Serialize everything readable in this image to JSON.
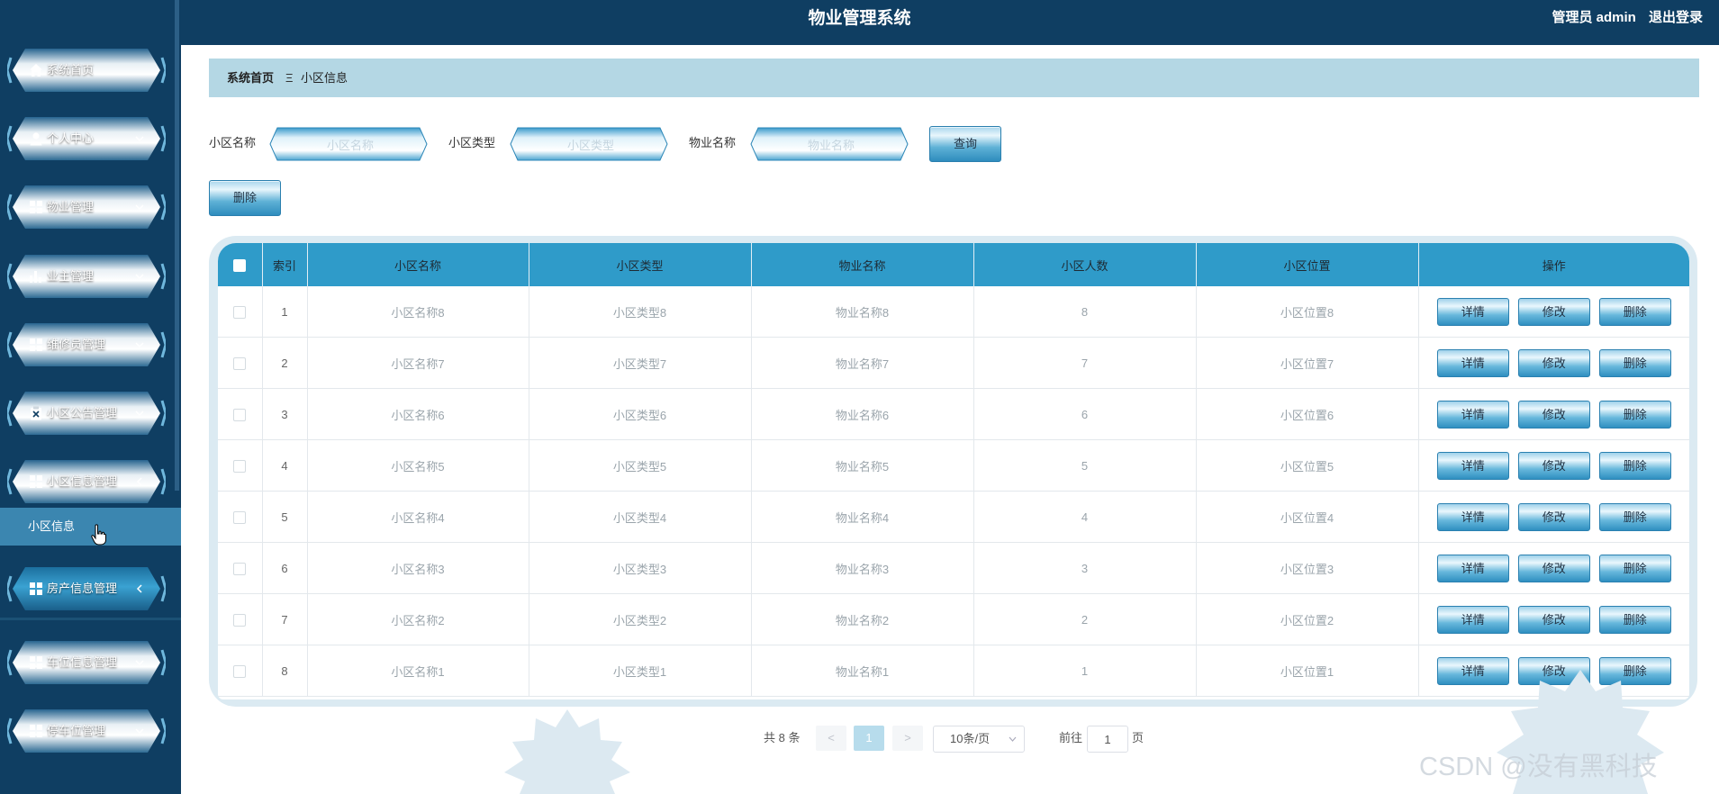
{
  "header": {
    "title": "物业管理系统",
    "user": "管理员 admin",
    "logout": "退出登录"
  },
  "sidebar": {
    "items": [
      {
        "label": "系统首页",
        "icon": "home-icon"
      },
      {
        "label": "个人中心",
        "icon": "user-icon"
      },
      {
        "label": "物业管理",
        "icon": "grid-icon"
      },
      {
        "label": "业主管理",
        "icon": "bar-chart-icon"
      },
      {
        "label": "维修员管理",
        "icon": "grid-icon"
      },
      {
        "label": "小区公告管理",
        "icon": "clipboard-icon"
      },
      {
        "label": "小区信息管理",
        "icon": "grid-icon"
      },
      {
        "label": "房产信息管理",
        "icon": "grid-icon"
      },
      {
        "label": "车位信息管理",
        "icon": "grid-icon"
      },
      {
        "label": "停车位管理",
        "icon": "grid-icon"
      }
    ],
    "active_sub": "小区信息"
  },
  "breadcrumb": {
    "home": "系统首页",
    "separator": "Ξ",
    "current": "小区信息"
  },
  "search": {
    "name_label": "小区名称",
    "name_placeholder": "小区名称",
    "type_label": "小区类型",
    "type_placeholder": "小区类型",
    "property_label": "物业名称",
    "property_placeholder": "物业名称",
    "query_button": "查询"
  },
  "toolbar": {
    "delete_button": "删除"
  },
  "table": {
    "columns": [
      "索引",
      "小区名称",
      "小区类型",
      "物业名称",
      "小区人数",
      "小区位置",
      "操作"
    ],
    "rows": [
      {
        "index": "1",
        "name": "小区名称8",
        "type": "小区类型8",
        "property": "物业名称8",
        "count": "8",
        "location": "小区位置8"
      },
      {
        "index": "2",
        "name": "小区名称7",
        "type": "小区类型7",
        "property": "物业名称7",
        "count": "7",
        "location": "小区位置7"
      },
      {
        "index": "3",
        "name": "小区名称6",
        "type": "小区类型6",
        "property": "物业名称6",
        "count": "6",
        "location": "小区位置6"
      },
      {
        "index": "4",
        "name": "小区名称5",
        "type": "小区类型5",
        "property": "物业名称5",
        "count": "5",
        "location": "小区位置5"
      },
      {
        "index": "5",
        "name": "小区名称4",
        "type": "小区类型4",
        "property": "物业名称4",
        "count": "4",
        "location": "小区位置4"
      },
      {
        "index": "6",
        "name": "小区名称3",
        "type": "小区类型3",
        "property": "物业名称3",
        "count": "3",
        "location": "小区位置3"
      },
      {
        "index": "7",
        "name": "小区名称2",
        "type": "小区类型2",
        "property": "物业名称2",
        "count": "2",
        "location": "小区位置2"
      },
      {
        "index": "8",
        "name": "小区名称1",
        "type": "小区类型1",
        "property": "物业名称1",
        "count": "1",
        "location": "小区位置1"
      }
    ],
    "actions": {
      "detail": "详情",
      "edit": "修改",
      "delete": "删除"
    }
  },
  "pagination": {
    "total": "共 8 条",
    "prev": "<",
    "current_page": "1",
    "next": ">",
    "page_size": "10条/页",
    "goto_prefix": "前往",
    "goto_value": "1",
    "goto_suffix": "页"
  },
  "watermark": "CSDN @没有黑科技",
  "colors": {
    "nav": "#0f3e62",
    "header_cell": "#2f9bc9",
    "breadcrumb": "#b4d7e4",
    "active_sub": "#3b86b0"
  }
}
